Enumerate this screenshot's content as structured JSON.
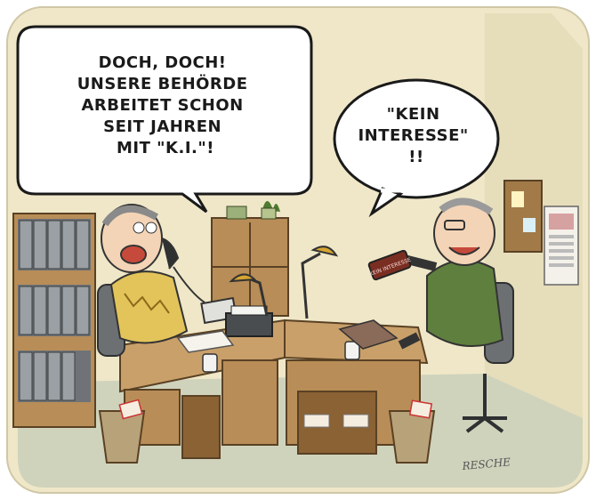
{
  "left_speech_bubble": {
    "lines": [
      "DOCH, DOCH!",
      "UNSERE BEHÖRDE",
      "ARBEITET SCHON",
      "SEIT JAHREN",
      "MIT \"K.I.\"!"
    ]
  },
  "right_speech_bubble": {
    "lines": [
      "\"KEIN",
      "INTERESSE\"",
      "!!"
    ]
  },
  "stamp_text": "KEIN INTERESSE",
  "signature": "RESCHE",
  "colors": {
    "wall": "#efe7c8",
    "floor": "#cfd3bc",
    "desk": "#c9a06a",
    "cabinet": "#7a7d80",
    "left_vest": "#e2c45a",
    "right_vest": "#5f7f3e",
    "stamp": "#c0392b"
  }
}
